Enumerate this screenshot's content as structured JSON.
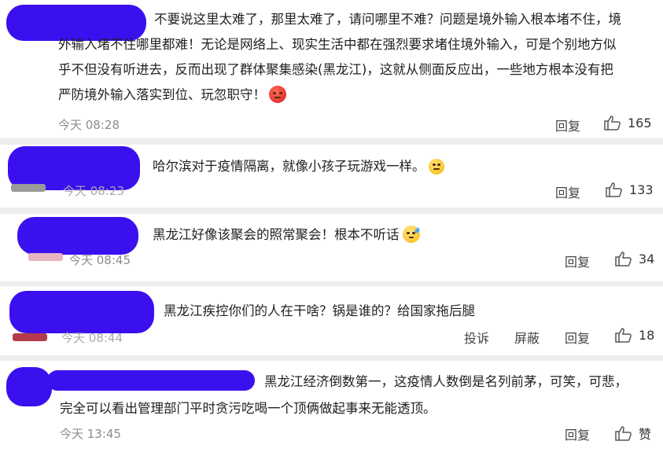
{
  "comments": [
    {
      "lines": [
        "不要说这里太难了，那里太难了，请问哪里不难？问题是境外输入根本堵不住，境",
        "外输入堵不住哪里都难！无论是网络上、现实生活中都在强烈要求堵住境外输入，可是个别地方似",
        "乎不但没有听进去，反而出现了群体聚集感染(黑龙江)，这就从侧面反应出，一些地方根本没有把",
        "严防境外输入落实到位、玩忽职守！"
      ],
      "emoji": "angry-face-emoji",
      "time": "今天 08:28",
      "reply": "回复",
      "likes": "165"
    },
    {
      "lines": [
        "哈尔滨对于疫情隔离，就像小孩子玩游戏一样。"
      ],
      "emoji": "shrug-emoji",
      "time": "今天 08:23",
      "reply": "回复",
      "likes": "133"
    },
    {
      "lines": [
        "黑龙江好像该聚会的照常聚会！根本不听话"
      ],
      "emoji": "sweat-face-emoji",
      "time": "今天 08:45",
      "reply": "回复",
      "likes": "34"
    },
    {
      "lines": [
        "黑龙江疾控你们的人在干啥？锅是谁的？给国家拖后腿"
      ],
      "time": "今天 08:44",
      "report": "投诉",
      "block": "屏蔽",
      "reply": "回复",
      "likes": "18"
    },
    {
      "lines": [
        "黑龙江经济倒数第一，这疫情人数倒是名列前茅，可笑，可悲，",
        "完全可以看出管理部门平时贪污吃喝一个顶俩做起事来无能透顶。"
      ],
      "time": "今天 13:45",
      "reply": "回复",
      "likes": "赞"
    }
  ],
  "colors": {
    "redaction": "#3b10ee",
    "separator": "#eeeeee",
    "meta_text": "#8c8c8c"
  }
}
